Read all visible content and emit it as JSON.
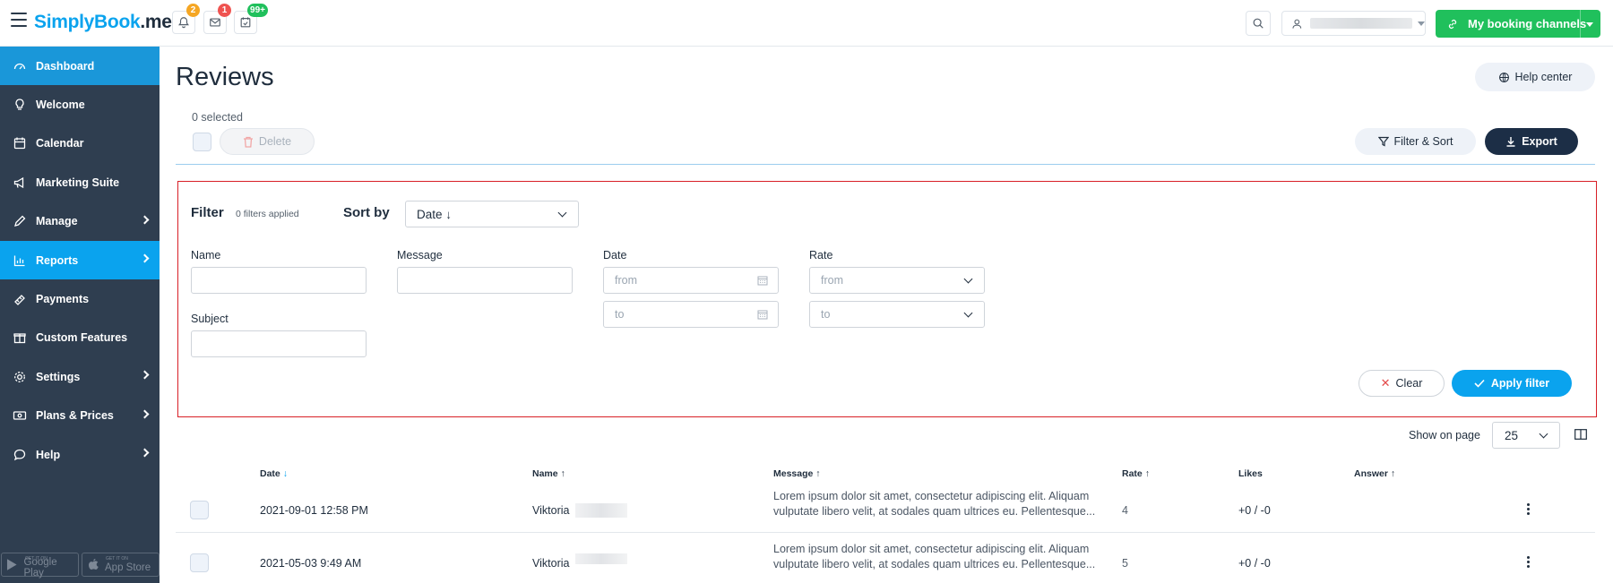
{
  "brand": {
    "logo_main": "SimplyBook",
    "logo_suffix": ".me"
  },
  "topbar": {
    "notifications_badge": "2",
    "messages_badge": "1",
    "bookings_badge": "99+",
    "badge_colors": {
      "notifications": "#f5a623",
      "messages": "#ef5350",
      "bookings": "#20c05c"
    },
    "booking_channels_label": "My booking channels"
  },
  "sidebar": {
    "items": [
      {
        "label": "Dashboard",
        "icon": "gauge-icon",
        "has_submenu": false
      },
      {
        "label": "Welcome",
        "icon": "lightbulb-icon",
        "has_submenu": false
      },
      {
        "label": "Calendar",
        "icon": "calendar-icon",
        "has_submenu": false
      },
      {
        "label": "Marketing Suite",
        "icon": "megaphone-icon",
        "has_submenu": false
      },
      {
        "label": "Manage",
        "icon": "pencil-icon",
        "has_submenu": true
      },
      {
        "label": "Reports",
        "icon": "bar-chart-icon",
        "has_submenu": true
      },
      {
        "label": "Payments",
        "icon": "wallet-icon",
        "has_submenu": false
      },
      {
        "label": "Custom Features",
        "icon": "gift-icon",
        "has_submenu": false
      },
      {
        "label": "Settings",
        "icon": "gear-icon",
        "has_submenu": true
      },
      {
        "label": "Plans & Prices",
        "icon": "money-icon",
        "has_submenu": true
      },
      {
        "label": "Help",
        "icon": "chat-bubble-icon",
        "has_submenu": true
      }
    ],
    "google_play_small": "GET IT ON",
    "google_play": "Google Play",
    "app_store_small": "GET IT ON",
    "app_store": "App Store"
  },
  "page": {
    "title": "Reviews",
    "help_center": "Help center",
    "selected_count": "0 selected",
    "delete_label": "Delete",
    "filter_sort_label": "Filter & Sort",
    "export_label": "Export"
  },
  "filter": {
    "heading": "Filter",
    "applied": "0 filters applied",
    "sort_by_label": "Sort by",
    "sort_value": "Date ↓",
    "name_label": "Name",
    "message_label": "Message",
    "date_label": "Date",
    "rate_label": "Rate",
    "subject_label": "Subject",
    "date_from_placeholder": "from",
    "date_to_placeholder": "to",
    "rate_from_placeholder": "from",
    "rate_to_placeholder": "to",
    "clear_label": "Clear",
    "apply_label": "Apply filter"
  },
  "pagination": {
    "show_on_page_label": "Show on page",
    "page_size": "25"
  },
  "table": {
    "columns": [
      {
        "label": "Date",
        "arrow": "↓"
      },
      {
        "label": "Name",
        "arrow": "↑"
      },
      {
        "label": "Message",
        "arrow": "↑"
      },
      {
        "label": "Rate",
        "arrow": "↑"
      },
      {
        "label": "Likes",
        "arrow": ""
      },
      {
        "label": "Answer",
        "arrow": "↑"
      }
    ],
    "rows": [
      {
        "date": "2021-09-01 12:58 PM",
        "name": "Viktoria",
        "message_line1": "Lorem ipsum dolor sit amet, consectetur adipiscing elit. Aliquam",
        "message_line2": "vulputate libero velit, at sodales quam ultrices eu. Pellentesque...",
        "rate": "4",
        "likes": "+0 / -0"
      },
      {
        "date": "2021-05-03 9:49 AM",
        "name": "Viktoria",
        "message_line1": "Lorem ipsum dolor sit amet, consectetur adipiscing elit. Aliquam",
        "message_line2": "vulputate libero velit, at sodales quam ultrices eu. Pellentesque...",
        "rate": "5",
        "likes": "+0 / -0"
      }
    ]
  }
}
